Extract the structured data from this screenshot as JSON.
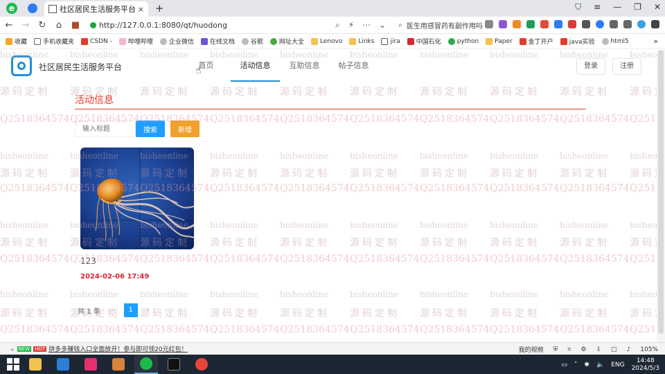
{
  "browser": {
    "tab_title": "社区居民生活服务平台",
    "tab_close": "×",
    "new_tab": "+",
    "url": "http://127.0.0.1:8080/qt/huodong",
    "search_text": "医生用感冒药有副作用吗",
    "bookmarks": [
      "收藏",
      "手机收藏夹",
      "CSDN -",
      "哔哩哔哩",
      "企业微信",
      "在线文档",
      "谷歌",
      "网址大全",
      "Lenovo",
      "Links",
      "jira",
      "中国石化",
      "python",
      "Paper",
      "金丁开户",
      "java实验",
      "html5"
    ],
    "status_new_tag": "NEW",
    "status_hot_tag": "HOT",
    "status_news": "拼多多赚钱入口全面放开！参与即可领20元红包！",
    "status_right": [
      "我的视频",
      "105%"
    ]
  },
  "site": {
    "name": "社区居民生活服务平台",
    "nav": [
      {
        "label": "首页"
      },
      {
        "label": "活动信息"
      },
      {
        "label": "互助信息"
      },
      {
        "label": "帖子信息"
      }
    ],
    "login_label": "登录",
    "register_label": "注册"
  },
  "section": {
    "title": "活动信息"
  },
  "search": {
    "placeholder": "输入标题",
    "search_label": "搜索",
    "add_label": "新增"
  },
  "cards": [
    {
      "title": "123",
      "time": "2024-02-06 17:49"
    }
  ],
  "pager": {
    "total": "共 1 条",
    "prev": "‹",
    "current": "1",
    "next": "›"
  },
  "watermark": {
    "en": "bisheonline",
    "cn": "源码定制",
    "qq": "Q2518364574"
  },
  "taskbar": {
    "lang": "ENG",
    "time": "14:48",
    "date": "2024/5/3"
  },
  "colors": {
    "accent": "#1e9fff",
    "title_red": "#e23a2d",
    "add_orange": "#f0a02c",
    "logo_blue": "#1f8fd6"
  }
}
